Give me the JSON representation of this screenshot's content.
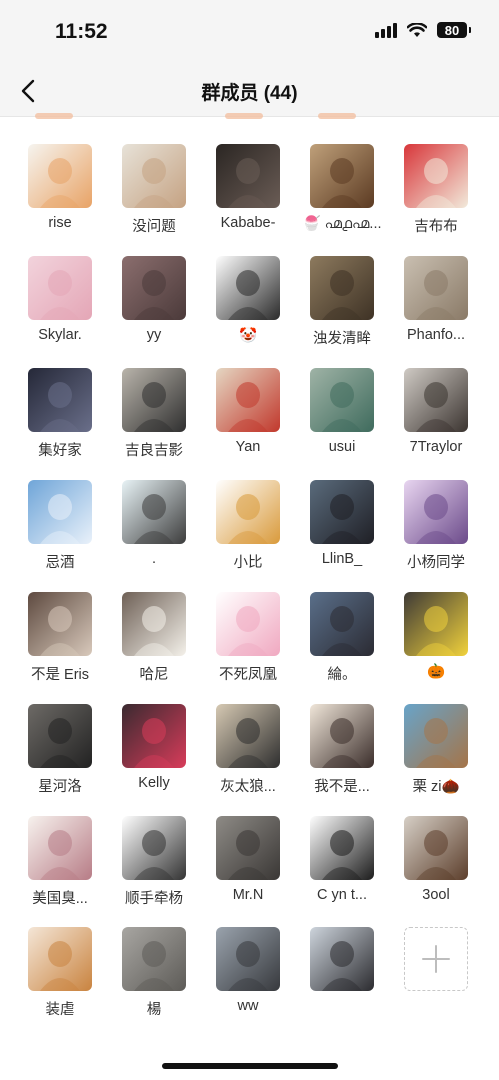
{
  "status_bar": {
    "time": "11:52",
    "battery": "80"
  },
  "nav": {
    "title": "群成员 (44)"
  },
  "members": [
    {
      "name": "rise",
      "colors": [
        "#f6f4ef",
        "#e8a366"
      ],
      "icon": "dog-avatar-icon"
    },
    {
      "name": "没问题",
      "colors": [
        "#e7e2d8",
        "#c5a282"
      ],
      "icon": "rabbit-avatar-icon"
    },
    {
      "name": "Kababe-",
      "colors": [
        "#2b2623",
        "#6a5c55"
      ],
      "icon": "people-photo-avatar-icon"
    },
    {
      "name": "🍧 ൶൧൶...",
      "colors": [
        "#bfa07a",
        "#5b3a22"
      ],
      "icon": "bear-avatar-icon"
    },
    {
      "name": "吉布布",
      "colors": [
        "#d8363a",
        "#f2eadb"
      ],
      "icon": "corgi-avatar-icon"
    },
    {
      "name": "Skylar.",
      "colors": [
        "#f2d3dc",
        "#e4a6b6"
      ],
      "icon": "anime-girl-avatar-icon"
    },
    {
      "name": "yy",
      "colors": [
        "#8b6e6e",
        "#4b3a3a"
      ],
      "icon": "cat-photo-avatar-icon"
    },
    {
      "name": "🤡",
      "colors": [
        "#ffffff",
        "#2a2a2a"
      ],
      "icon": "cartoon-girl-avatar-icon"
    },
    {
      "name": "浊发清眸",
      "colors": [
        "#8d7a5e",
        "#3e3225"
      ],
      "icon": "couple-photo-avatar-icon"
    },
    {
      "name": "Phanfo...",
      "colors": [
        "#c9bfb1",
        "#8a7a67"
      ],
      "icon": "cat-avatar-icon"
    },
    {
      "name": "集好家",
      "colors": [
        "#252838",
        "#6a6f8a"
      ],
      "icon": "stage-photo-avatar-icon"
    },
    {
      "name": "吉良吉影",
      "colors": [
        "#b9b4ab",
        "#2f2f2f"
      ],
      "icon": "panda-man-avatar-icon"
    },
    {
      "name": "Yan",
      "colors": [
        "#e5d6c2",
        "#c1382c"
      ],
      "icon": "pig-figure-avatar-icon"
    },
    {
      "name": "usui",
      "colors": [
        "#9fb3a6",
        "#3f6b5d"
      ],
      "icon": "aerial-photo-avatar-icon"
    },
    {
      "name": "7Traylor",
      "colors": [
        "#cfcac4",
        "#3b3430"
      ],
      "icon": "man-portrait-avatar-icon"
    },
    {
      "name": "忌酒",
      "colors": [
        "#6fa5d8",
        "#e9f1fa"
      ],
      "icon": "sky-photo-avatar-icon"
    },
    {
      "name": ".",
      "colors": [
        "#e8f3f6",
        "#3c3c3c"
      ],
      "icon": "sticker-avatar-icon"
    },
    {
      "name": "小比",
      "colors": [
        "#ffffff",
        "#d99a3b"
      ],
      "icon": "burger-avatar-icon"
    },
    {
      "name": "LlinB_",
      "colors": [
        "#5a6b7c",
        "#1f1f25"
      ],
      "icon": "girl-photo-avatar-icon"
    },
    {
      "name": "小杨同学",
      "colors": [
        "#e8d5f0",
        "#6b4a8a"
      ],
      "icon": "anime-character-avatar-icon"
    },
    {
      "name": "不是 Eris",
      "colors": [
        "#5e4a40",
        "#d8c9bb"
      ],
      "icon": "cat-photo-avatar-icon"
    },
    {
      "name": "哈尼",
      "colors": [
        "#6e6056",
        "#f4f1ea"
      ],
      "icon": "girl-with-toy-avatar-icon"
    },
    {
      "name": "不死凤凰",
      "colors": [
        "#ffffff",
        "#f0a8c0"
      ],
      "icon": "hello-kitty-avatar-icon"
    },
    {
      "name": "綸。",
      "colors": [
        "#5a6f8a",
        "#2b2b33"
      ],
      "icon": "anime-boy-avatar-icon"
    },
    {
      "name": "🎃",
      "colors": [
        "#3e3a36",
        "#f1d23c"
      ],
      "icon": "food-photo-avatar-icon"
    },
    {
      "name": "星河洛",
      "colors": [
        "#6d6a66",
        "#222222"
      ],
      "icon": "figure-avatar-icon"
    },
    {
      "name": "Kelly",
      "colors": [
        "#3a2a30",
        "#d83c5a"
      ],
      "icon": "girl-portrait-avatar-icon"
    },
    {
      "name": "灰太狼...",
      "colors": [
        "#d6c9b3",
        "#2e2e2e"
      ],
      "icon": "motorbike-avatar-icon"
    },
    {
      "name": "我不是...",
      "colors": [
        "#f0e6d9",
        "#3a2d2a"
      ],
      "icon": "anime-girl-avatar-icon"
    },
    {
      "name": "栗 zi🌰",
      "colors": [
        "#68a4c9",
        "#a57448"
      ],
      "icon": "beach-photo-avatar-icon"
    },
    {
      "name": "美国臭...",
      "colors": [
        "#f7f2ee",
        "#b77c86"
      ],
      "icon": "anime-boy-avatar-icon"
    },
    {
      "name": "顺手牵杨",
      "colors": [
        "#ffffff",
        "#333333"
      ],
      "icon": "sketch-avatar-icon"
    },
    {
      "name": "Mr.N",
      "colors": [
        "#8e8b86",
        "#3a3735"
      ],
      "icon": "kid-photo-avatar-icon"
    },
    {
      "name": "C  yn t...",
      "colors": [
        "#ffffff",
        "#1c1c1c"
      ],
      "icon": "beanie-girl-avatar-icon"
    },
    {
      "name": "3ool",
      "colors": [
        "#d6cfc6",
        "#5c3e2b"
      ],
      "icon": "dog-figure-avatar-icon"
    },
    {
      "name": "装虐",
      "colors": [
        "#f4e6d7",
        "#c9833f"
      ],
      "icon": "teddy-bear-avatar-icon"
    },
    {
      "name": "楊",
      "colors": [
        "#a8a6a2",
        "#5d5b57"
      ],
      "icon": "collage-avatar-icon"
    },
    {
      "name": "ww",
      "colors": [
        "#9aa3ad",
        "#37393d"
      ],
      "icon": "seaside-photo-avatar-icon"
    },
    {
      "name": "",
      "colors": [
        "#cdd4dc",
        "#2b2b2f"
      ],
      "icon": "silhouette-avatar-icon"
    }
  ],
  "add_button": {
    "icon": "plus-icon"
  }
}
